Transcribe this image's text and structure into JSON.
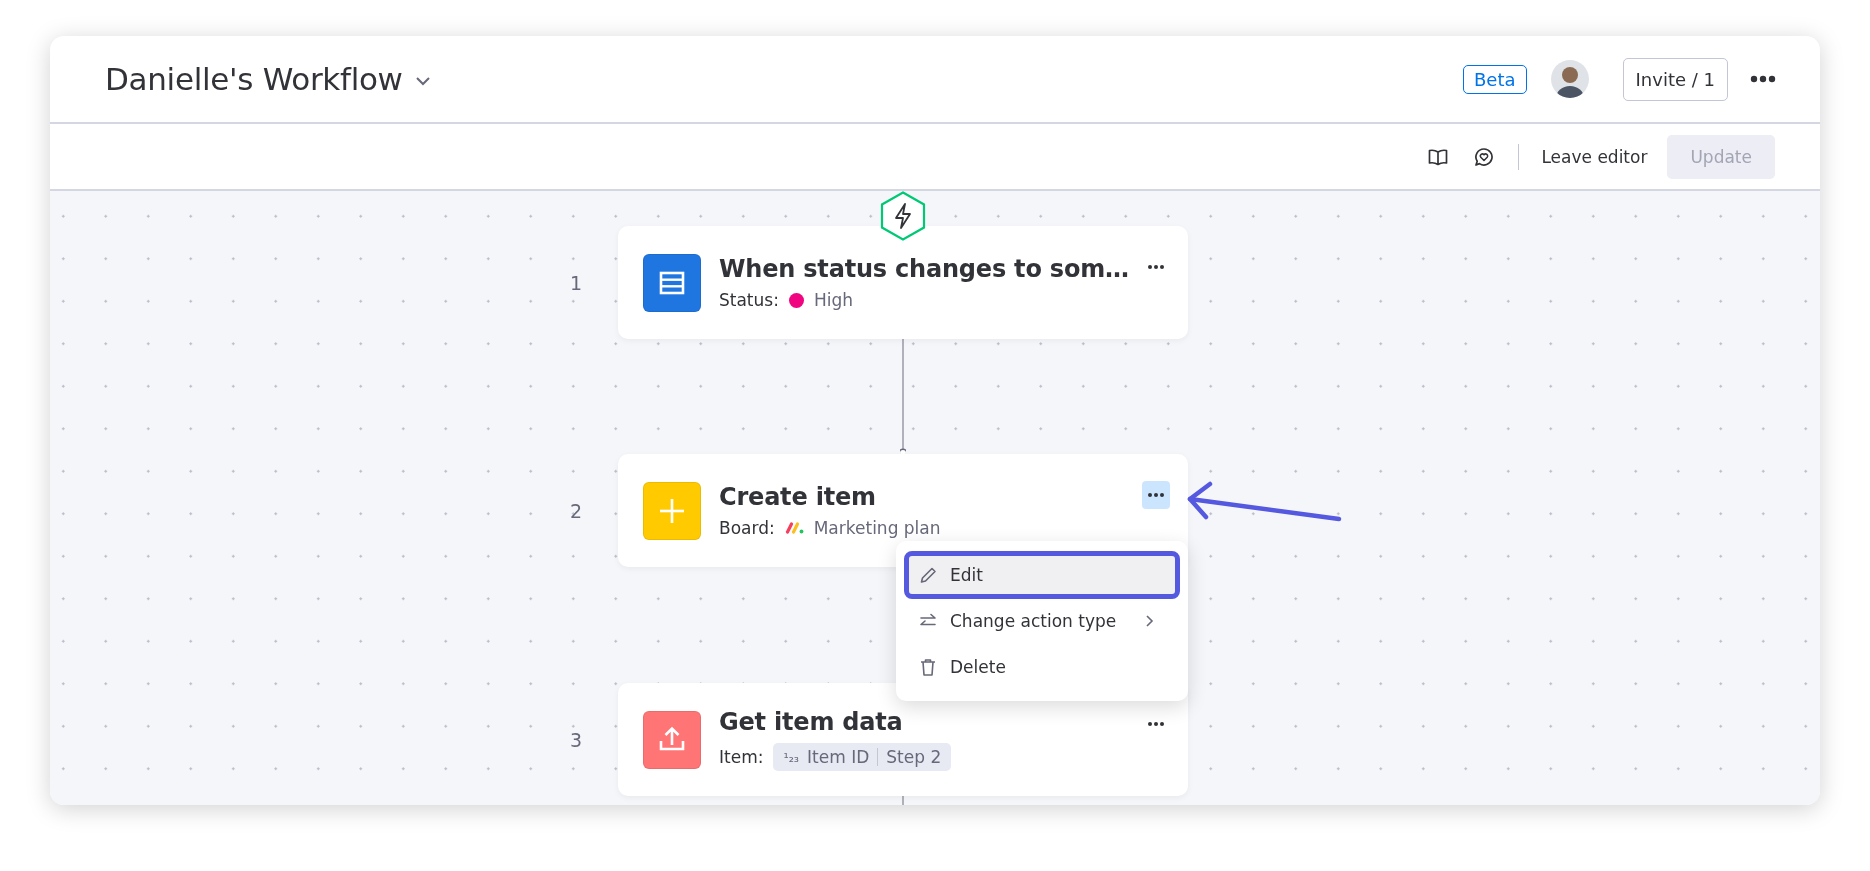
{
  "header": {
    "title": "Danielle's Workflow",
    "badge": "Beta",
    "invite_button": "Invite / 1"
  },
  "toolbar": {
    "leave_button": "Leave editor",
    "update_button": {
      "label": "Update",
      "disabled": true
    }
  },
  "steps": [
    {
      "number": "1",
      "kind": "trigger",
      "title": "When status changes to som…",
      "field_label": "Status:",
      "value": {
        "kind": "status",
        "text": "High",
        "color": "#f0047f"
      },
      "menu_active": false
    },
    {
      "number": "2",
      "kind": "create",
      "title": "Create item",
      "field_label": "Board:",
      "value": {
        "kind": "board",
        "text": "Marketing plan"
      },
      "menu_active": true
    },
    {
      "number": "3",
      "kind": "fetch",
      "title": "Get item data",
      "field_label": "Item:",
      "value": {
        "kind": "chip",
        "icon": "¹₂₃",
        "text": "Item ID",
        "source": "Step 2"
      },
      "menu_active": false
    }
  ],
  "menu": {
    "items": [
      {
        "label": "Edit",
        "kind": "edit",
        "selected": true,
        "submenu": false
      },
      {
        "label": "Change action type",
        "kind": "swap",
        "selected": false,
        "submenu": true
      },
      {
        "label": "Delete",
        "kind": "delete",
        "selected": false,
        "submenu": false
      }
    ]
  }
}
